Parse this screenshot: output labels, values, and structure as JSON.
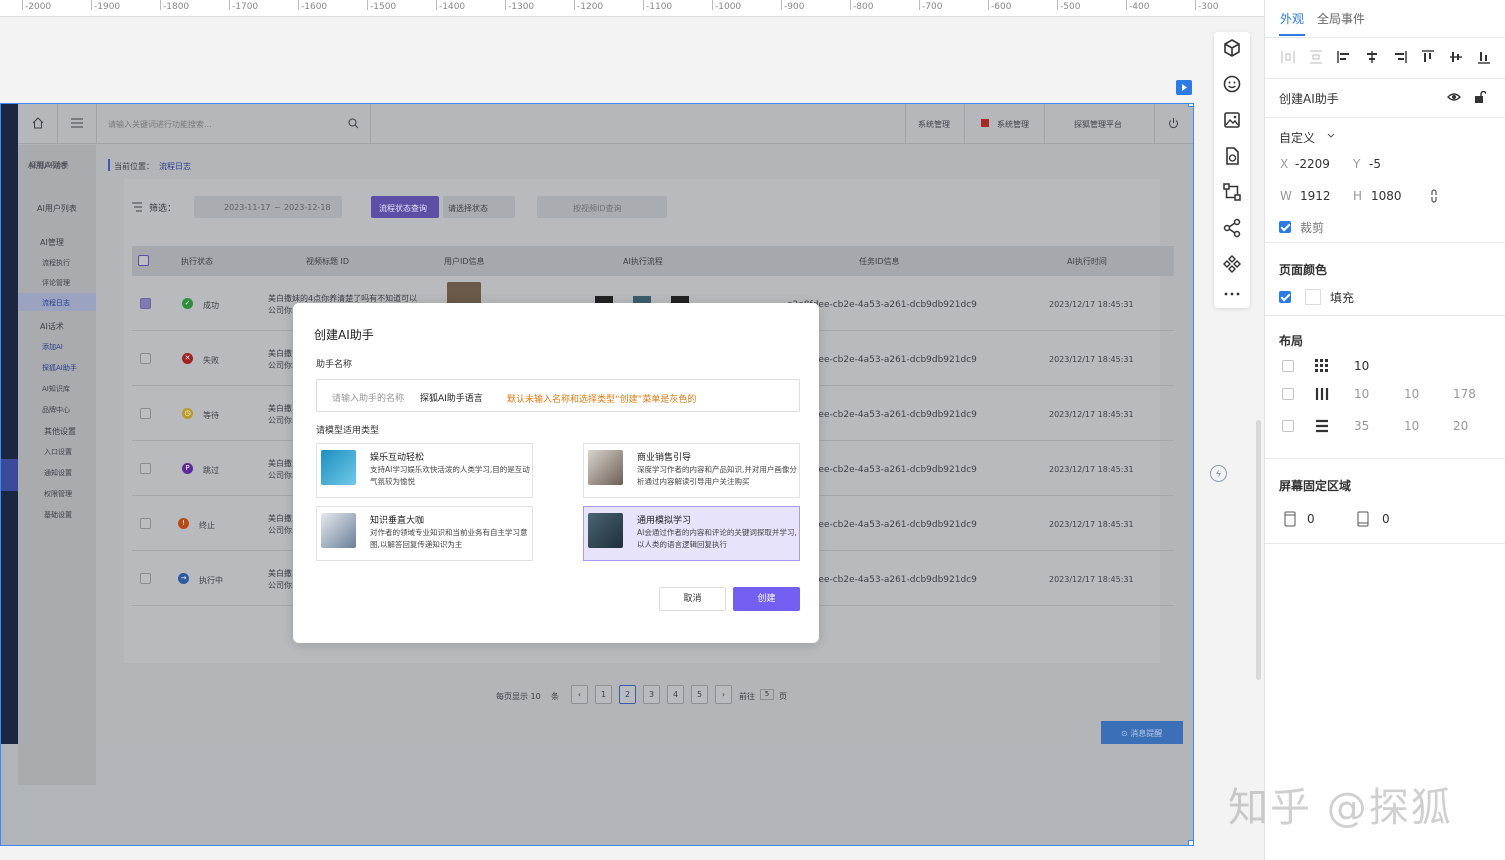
{
  "ruler": {
    "labels": [
      "-2000",
      "-1900",
      "-1800",
      "-1700",
      "-1600",
      "-1500",
      "-1400",
      "-1300",
      "-1200",
      "-1100",
      "-1000",
      "-900",
      "-800",
      "-700",
      "-600",
      "-500",
      "-400",
      "-300"
    ]
  },
  "app": {
    "search_placeholder": "请输入关键词进行功能搜索...",
    "top_links": [
      "系统管理",
      "系统管理",
      "探狐管理平台"
    ],
    "breadcrumb_prefix": "当前位置：",
    "breadcrumb_current": "流程日志",
    "sidebar": {
      "brand": "探狐AI助手",
      "items": [
        "AI用户列表",
        "AI管理",
        "流程执行",
        "评论管理",
        "流程日志",
        "AI话术",
        "添加AI",
        "探狐AI助手",
        "AI知识库",
        "品牌中心",
        "其他设置",
        "入口设置",
        "通知设置",
        "权限管理",
        "基础设置"
      ]
    },
    "filter": {
      "label": "筛选：",
      "date_start": "2023-11-17",
      "date_sep": "~",
      "date_end": "2023-12-18",
      "query_button": "流程状态查询",
      "status_select": "请选择状态",
      "id_placeholder": "按视频ID查询"
    },
    "table": {
      "headers": [
        "执行状态",
        "视频标题 ID",
        "用户ID信息",
        "AI执行流程",
        "任务ID信息",
        "AI执行时间"
      ],
      "rows": [
        {
          "status": "成功",
          "title": "美白撒妹的4点你养清楚了吗有不知道可以",
          "title2": "公司你...",
          "task": "e2e8fdee-cb2e-4a53-a261-dcb9db921dc9",
          "time": "2023/12/17 18:45:31"
        },
        {
          "status": "失败",
          "title": "美白撒...",
          "title2": "公司你...",
          "task": "e2e8fdee-cb2e-4a53-a261-dcb9db921dc9",
          "time": "2023/12/17 18:45:31"
        },
        {
          "status": "等待",
          "title": "美白撒...",
          "title2": "公司你...",
          "task": "e2e8fdee-cb2e-4a53-a261-dcb9db921dc9",
          "time": "2023/12/17 18:45:31"
        },
        {
          "status": "跳过",
          "title": "美白撒...",
          "title2": "公司你...",
          "task": "e2e8fdee-cb2e-4a53-a261-dcb9db921dc9",
          "time": "2023/12/17 18:45:31"
        },
        {
          "status": "终止",
          "title": "美白撒...",
          "title2": "公司你...",
          "task": "e2e8fdee-cb2e-4a53-a261-dcb9db921dc9",
          "time": "2023/12/17 18:45:31"
        },
        {
          "status": "执行中",
          "title": "美白撒...",
          "title2": "公司你...",
          "task": "e2e8fdee-cb2e-4a53-a261-dcb9db921dc9",
          "time": "2023/12/17 18:45:31"
        }
      ]
    },
    "pagination": {
      "per_page": "每页显示 10",
      "unit": "条",
      "pages": [
        "1",
        "2",
        "3",
        "4",
        "5"
      ],
      "goto": "前往",
      "goto_val": "5",
      "page_unit": "页"
    },
    "message_button": "⊙ 消息提醒"
  },
  "modal": {
    "title": "创建AI助手",
    "name_label": "助手名称",
    "name_placeholder": "请输入助手的名称",
    "name_value": "探狐AI助手语言",
    "name_hint": "默认未输入名称和选择类型“创建”菜单是灰色的",
    "type_label": "请模型适用类型",
    "options": [
      {
        "title": "娱乐互动轻松",
        "desc": "支持AI学习娱乐欢快活泼的人类学习,目的是互动气氛较为愉悦"
      },
      {
        "title": "商业销售引导",
        "desc": "深度学习作者的内容和产品知识,并对用户画像分析通过内容解读引导用户关注购买"
      },
      {
        "title": "知识垂直大咖",
        "desc": "对作者的领域专业知识和当前业务有自主学习意图,以解答回复传递知识为主"
      },
      {
        "title": "通用模拟学习",
        "desc": "AI会通过作者的内容和评论的关键词探取并学习,以人类的语言逻辑回复执行"
      }
    ],
    "cancel": "取消",
    "create": "创建"
  },
  "panel": {
    "tabs": [
      "外观",
      "全局事件"
    ],
    "component_name": "创建AI助手",
    "size_preset": "自定义",
    "x_label": "X",
    "x_value": "-2209",
    "y_label": "Y",
    "y_value": "-5",
    "w_label": "W",
    "w_value": "1912",
    "h_label": "H",
    "h_value": "1080",
    "clip_label": "裁剪",
    "page_color_title": "页面颜色",
    "fill_label": "填充",
    "layout_title": "布局",
    "grid_value": "10",
    "cols": [
      "10",
      "10",
      "178"
    ],
    "rows": [
      "35",
      "10",
      "20"
    ],
    "fixed_title": "屏幕固定区域",
    "fixed_top": "0",
    "fixed_bottom": "0"
  },
  "watermark": "知乎 @探狐",
  "colors": {
    "accent": "#2c7be5",
    "primary": "#7360f2",
    "hint": "#e07a13",
    "selection": "#3d8af7"
  }
}
